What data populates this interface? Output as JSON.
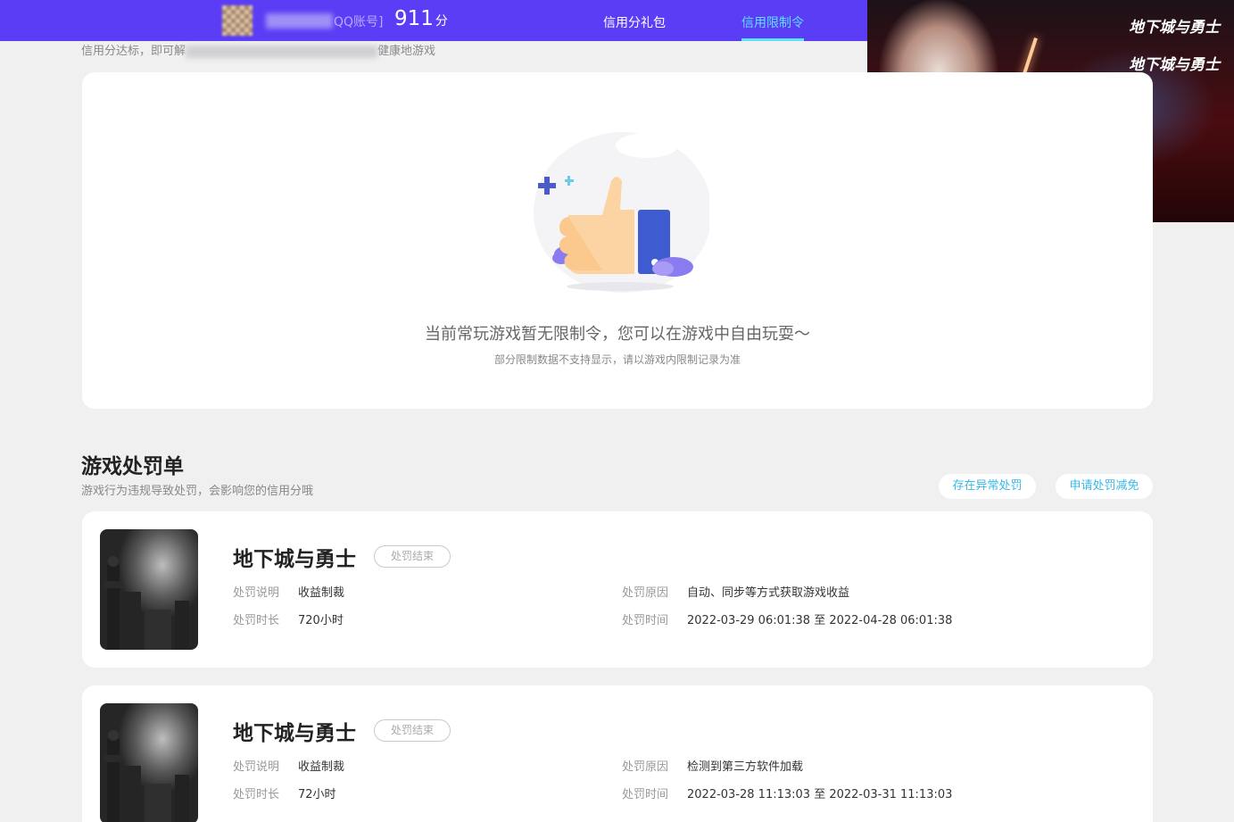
{
  "header": {
    "qq_label": "QQ账号]",
    "score": "911",
    "score_unit": "分",
    "tabs": [
      {
        "label": "信用分礼包",
        "active": false
      },
      {
        "label": "信用限制令",
        "active": true
      }
    ],
    "accent_color": "#5b3df5",
    "active_tab_color": "#5ee0ff"
  },
  "subtitle": {
    "prefix": "信用分达标，即可解",
    "suffix": "健康地游戏"
  },
  "banner": {
    "logo_1": "地下城与勇士",
    "logo_2": "地下城与勇士"
  },
  "status": {
    "main_text": "当前常玩游戏暂无限制令，您可以在游戏中自由玩耍～",
    "sub_text": "部分限制数据不支持显示，请以游戏内限制记录为准"
  },
  "penalties": {
    "title": "游戏处罚单",
    "description": "游戏行为违规导致处罚，会影响您的信用分哦",
    "actions": [
      "存在异常处罚",
      "申请处罚减免"
    ],
    "labels": {
      "desc": "处罚说明",
      "duration": "处罚时长",
      "reason": "处罚原因",
      "time": "处罚时间"
    },
    "items": [
      {
        "game": "地下城与勇士",
        "status": "处罚结束",
        "desc": "收益制裁",
        "duration": "720小时",
        "reason": "自动、同步等方式获取游戏收益",
        "time": "2022-03-29 06:01:38 至 2022-04-28 06:01:38"
      },
      {
        "game": "地下城与勇士",
        "status": "处罚结束",
        "desc": "收益制裁",
        "duration": "72小时",
        "reason": "检测到第三方软件加载",
        "time": "2022-03-28 11:13:03 至 2022-03-31 11:13:03"
      }
    ]
  }
}
